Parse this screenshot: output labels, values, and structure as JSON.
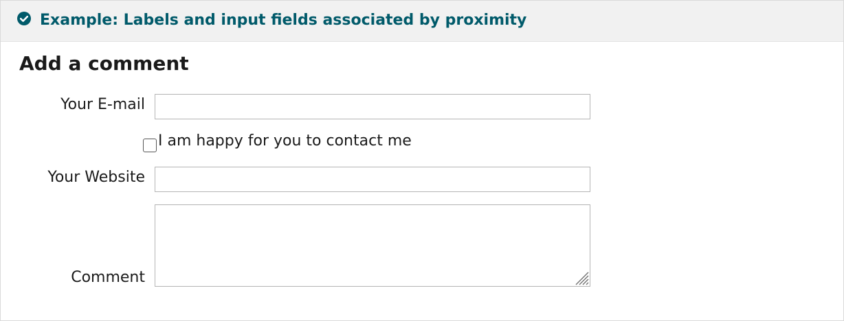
{
  "example": {
    "title": "Example: Labels and input fields associated by proximity",
    "status_icon": "check-circle-icon",
    "accent_color": "#005a6a"
  },
  "form": {
    "heading": "Add a comment",
    "email": {
      "label": "Your E-mail",
      "value": ""
    },
    "contact_checkbox": {
      "label": "I am happy for you to contact me",
      "checked": false
    },
    "website": {
      "label": "Your Website",
      "value": ""
    },
    "comment": {
      "label": "Comment",
      "value": "",
      "resize_icon": "resize-grip-icon"
    }
  }
}
